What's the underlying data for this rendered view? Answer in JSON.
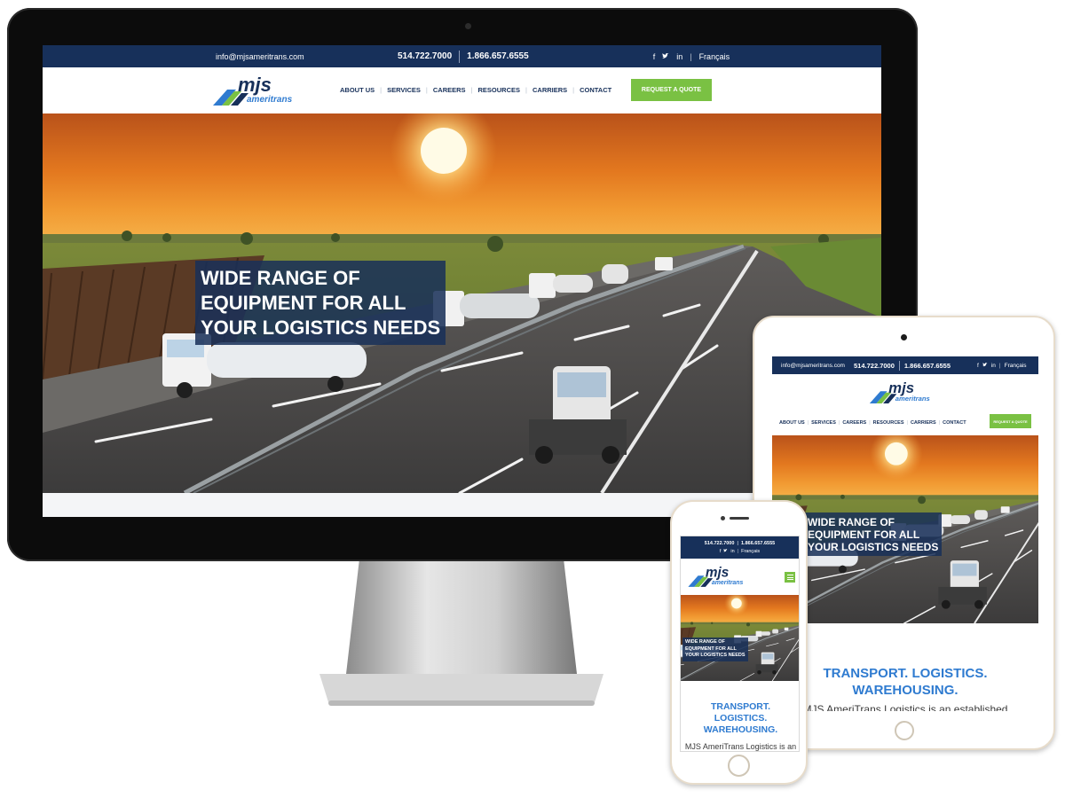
{
  "site": {
    "email": "info@mjsameritrans.com",
    "phone_local": "514.722.7000",
    "phone_toll_free": "1.866.657.6555",
    "language_link": "Français",
    "social": {
      "facebook": "f",
      "twitter": "t",
      "linkedin": "in"
    },
    "logo": {
      "word": "mjs",
      "sub": "ameritrans"
    },
    "nav": [
      "ABOUT US",
      "SERVICES",
      "CAREERS",
      "RESOURCES",
      "CARRIERS",
      "CONTACT"
    ],
    "quote_button": "REQUEST A QUOTE",
    "hero_headline": [
      "WIDE RANGE OF",
      "EQUIPMENT FOR ALL",
      "YOUR LOGISTICS NEEDS"
    ],
    "tagline_lines_tablet": [
      "TRANSPORT. LOGISTICS.",
      "WAREHOUSING."
    ],
    "tagline_lines_phone": [
      "TRANSPORT.",
      "LOGISTICS.",
      "WAREHOUSING."
    ],
    "body_tablet": "MJS AmeriTrans Logistics is an established",
    "body_phone": "MJS AmeriTrans Logistics is an"
  },
  "colors": {
    "navy": "#17305a",
    "green": "#7ac143",
    "accent_blue": "#2f7bd0",
    "sunset_orange": "#e8791f"
  },
  "icons": {
    "facebook": "facebook-icon",
    "twitter": "twitter-icon",
    "linkedin": "linkedin-icon",
    "menu": "hamburger-menu-icon"
  }
}
